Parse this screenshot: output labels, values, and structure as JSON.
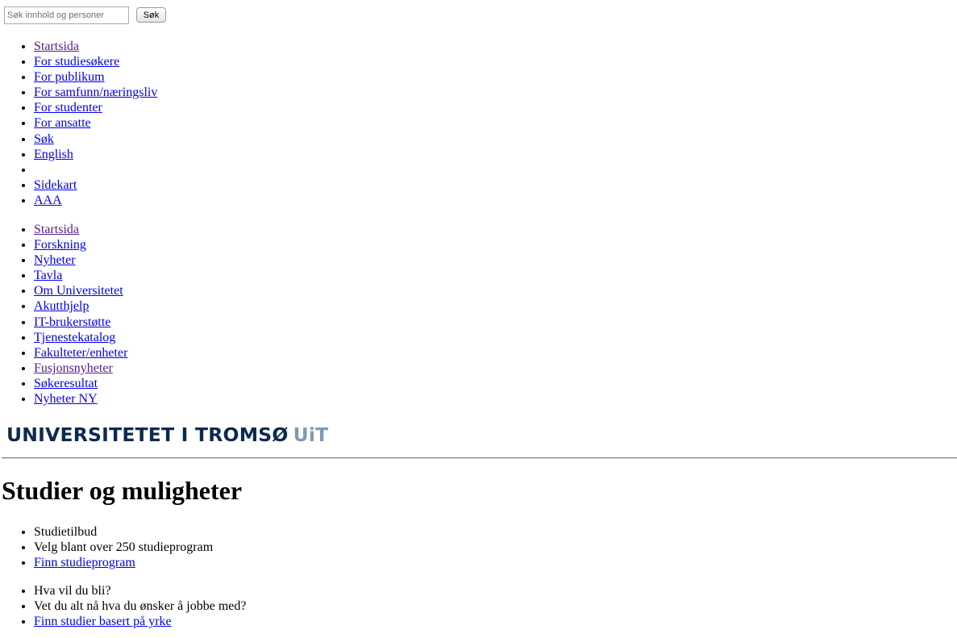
{
  "search": {
    "placeholder": "Søk innhold og personer",
    "button_label": "Søk"
  },
  "top_nav": {
    "items": [
      {
        "label": "Startsida"
      },
      {
        "label": "For studiesøkere"
      },
      {
        "label": "For publikum"
      },
      {
        "label": "For samfunn/næringsliv"
      },
      {
        "label": "For studenter"
      },
      {
        "label": "For ansatte"
      },
      {
        "label": "Søk"
      },
      {
        "label": "English"
      },
      {
        "label": ""
      },
      {
        "label": "Sidekart"
      },
      {
        "label": "AAA"
      }
    ]
  },
  "main_nav": {
    "items": [
      {
        "label": "Startsida"
      },
      {
        "label": "Forskning"
      },
      {
        "label": "Nyheter"
      },
      {
        "label": "Tavla"
      },
      {
        "label": "Om Universitetet"
      },
      {
        "label": "Akutthjelp"
      },
      {
        "label": "IT-brukerstøtte"
      },
      {
        "label": "Tjenestekatalog"
      },
      {
        "label": "Fakulteter/enheter"
      },
      {
        "label": "Fusjonsnyheter"
      },
      {
        "label": "Søkeresultat"
      },
      {
        "label": "Nyheter NY"
      }
    ]
  },
  "logo": {
    "name": "UNIVERSITETET I TROMSØ",
    "abbr": "UiT",
    "color_main": "#0b2a4d",
    "color_abbr": "#7f9ab0"
  },
  "page": {
    "title": "Studier og muligheter",
    "study_offer": {
      "heading": "Studietilbud",
      "text": "Velg blant over 250 studieprogram",
      "link": "Finn studieprogram"
    },
    "career": {
      "heading": "Hva vil du bli?",
      "text": "Vet du alt nå hva du ønsker å jobbe med?",
      "link": "Finn studier basert på yrke"
    }
  },
  "colors": {
    "link": "#0000ee",
    "visited_link": "#551a8b"
  }
}
